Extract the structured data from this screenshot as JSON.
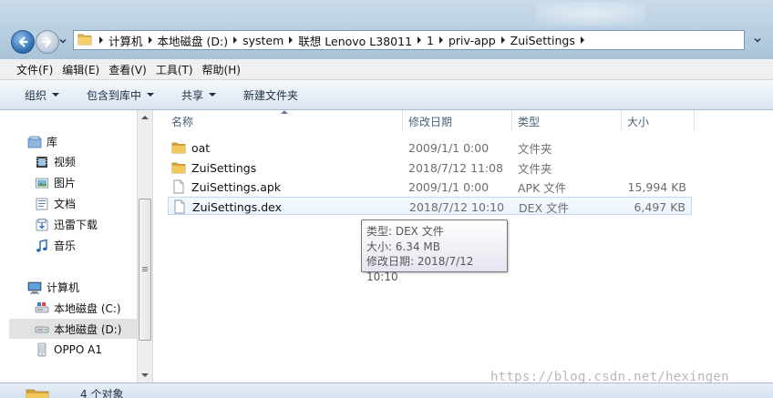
{
  "address": {
    "crumbs": [
      "计算机",
      "本地磁盘 (D:)",
      "system",
      "联想 Lenovo L38011",
      "1",
      "priv-app",
      "ZuiSettings"
    ]
  },
  "menu": {
    "items": [
      "文件(F)",
      "编辑(E)",
      "查看(V)",
      "工具(T)",
      "帮助(H)"
    ]
  },
  "toolbar": {
    "organize": "组织",
    "include_in_library": "包含到库中",
    "share": "共享",
    "new_folder": "新建文件夹"
  },
  "nav": {
    "libraries": {
      "label": "库",
      "items": [
        "视频",
        "图片",
        "文档",
        "迅雷下载",
        "音乐"
      ]
    },
    "computer": {
      "label": "计算机",
      "items": [
        "本地磁盘 (C:)",
        "本地磁盘 (D:)",
        "OPPO A1"
      ]
    },
    "selected": "本地磁盘 (D:)"
  },
  "columns": {
    "name": "名称",
    "modified": "修改日期",
    "type": "类型",
    "size": "大小"
  },
  "files": [
    {
      "name": "oat",
      "modified": "2009/1/1 0:00",
      "type": "文件夹",
      "size": "",
      "icon": "folder-icon"
    },
    {
      "name": "ZuiSettings",
      "modified": "2018/7/12 11:08",
      "type": "文件夹",
      "size": "",
      "icon": "folder-icon"
    },
    {
      "name": "ZuiSettings.apk",
      "modified": "2009/1/1 0:00",
      "type": "APK 文件",
      "size": "15,994 KB",
      "icon": "file-icon"
    },
    {
      "name": "ZuiSettings.dex",
      "modified": "2018/7/12 10:10",
      "type": "DEX 文件",
      "size": "6,497 KB",
      "icon": "file-icon",
      "selected": true
    }
  ],
  "tooltip": {
    "type": "类型: DEX 文件",
    "size": "大小: 6.34 MB",
    "modified": "修改日期: 2018/7/12 10:10"
  },
  "status": {
    "count": "4 个对象"
  },
  "watermark": "https://blog.csdn.net/hexingen",
  "colors": {
    "accent": "#2a6bb0",
    "selection": "#e9f2fb",
    "folder": "#e7b64a"
  }
}
